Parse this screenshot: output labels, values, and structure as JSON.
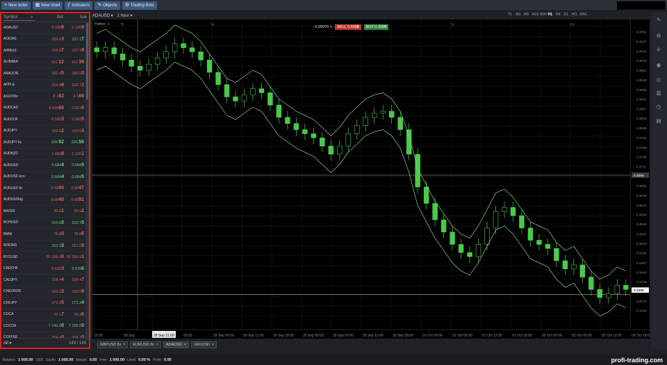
{
  "toolbar": {
    "buttons": [
      {
        "label": "New order",
        "icon": "plus-icon"
      },
      {
        "label": "New chart",
        "icon": "chart-icon"
      },
      {
        "label": "Indicators",
        "icon": "indicators-icon"
      },
      {
        "label": "Objects",
        "icon": "objects-icon"
      },
      {
        "label": "Trading Bots",
        "icon": "bot-icon"
      }
    ]
  },
  "symbols_panel": {
    "search_placeholder": "Symbol",
    "bid_header": "Bid",
    "ask_header": "Ask",
    "rows": [
      {
        "name": "ADAUSD",
        "bid": "0.339",
        "bid_big": "8",
        "ask": "0.339",
        "ask_big": "9",
        "bc": "red",
        "ac": "red"
      },
      {
        "name": "ADIDAS",
        "bid": "226.6",
        "bid_big": "3",
        "ask": "227.1",
        "ask_big": "7",
        "bc": "red",
        "ac": "green"
      },
      {
        "name": "AIRBUS",
        "bid": "126.8",
        "bid_big": "7",
        "ask": "127.1",
        "ask_big": "9",
        "bc": "red",
        "ac": "red"
      },
      {
        "name": "ALIBABA",
        "bid": "112.",
        "bid_big": "12",
        "ask": "112.",
        "ask_big": "39",
        "bc": "red",
        "ac": "red"
      },
      {
        "name": "AMAZON",
        "bid": "182.8",
        "bid_big": "5",
        "ask": "183.0",
        "ask_big": "0",
        "bc": "red",
        "ac": "red"
      },
      {
        "name": "APPLE",
        "bid": "226.4",
        "bid_big": "8",
        "ask": "226.7",
        "ask_big": "1",
        "bc": "red",
        "ac": "red"
      },
      {
        "name": "ASX200v",
        "bid": "8 1",
        "bid_big": "62",
        "ask": "8 1",
        "ask_big": "66",
        "bc": "red",
        "ac": "red"
      },
      {
        "name": "AUDCAD",
        "bid": "0.926",
        "bid_big": "68",
        "ask": "0.927",
        "ask_big": "0",
        "bc": "red",
        "ac": "red"
      },
      {
        "name": "AUDCHF",
        "bid": "0.583",
        "bid_big": "3",
        "ask": "0.583",
        "ask_big": "5",
        "bc": "red",
        "ac": "red"
      },
      {
        "name": "AUDJPY",
        "bid": "100.5",
        "bid_big": "2",
        "ask": "100.5",
        "ask_big": "3",
        "bc": "red",
        "ac": "red"
      },
      {
        "name": "AUDJPY fix",
        "bid": "100.",
        "bid_big": "52",
        "ask": "100.",
        "ask_big": "56",
        "bc": "green",
        "ac": "green"
      },
      {
        "name": "AUDNZD",
        "bid": "1.099",
        "bid_big": "8",
        "ask": "1.100",
        "ask_big": "1",
        "bc": "red",
        "ac": "red"
      },
      {
        "name": "AUDUSD",
        "bid": "0.684",
        "bid_big": "4",
        "ask": "0.684",
        "ask_big": "5",
        "bc": "green",
        "ac": "green"
      },
      {
        "name": "AUDUSD ecn",
        "bid": "0.684",
        "bid_big": "4",
        "ask": "0.684",
        "ask_big": "5",
        "bc": "green",
        "ac": "green"
      },
      {
        "name": "AUDUSD fix",
        "bid": "0.68",
        "bid_big": "44",
        "ask": "0.68",
        "ask_big": "47",
        "bc": "red",
        "ac": "red"
      },
      {
        "name": "AUDUSDbig",
        "bid": "0.68",
        "bid_big": "40",
        "ask": "0.68",
        "ask_big": "51",
        "bc": "red",
        "ac": "red"
      },
      {
        "name": "BAYER",
        "bid": "30.0",
        "bid_big": "1",
        "ask": "30.1",
        "ask_big": "2",
        "bc": "red",
        "ac": "red"
      },
      {
        "name": "BCHUSD",
        "bid": "310.6",
        "bid_big": "0",
        "ask": "310.7",
        "ask_big": "0",
        "bc": "green",
        "ac": "green"
      },
      {
        "name": "BMW",
        "bid": "76.8",
        "bid_big": "0",
        "ask": "76.9",
        "ask_big": "6",
        "bc": "red",
        "ac": "red"
      },
      {
        "name": "BOEING",
        "bid": "151.3",
        "bid_big": "3",
        "ask": "151.6",
        "ask_big": "5",
        "bc": "green",
        "ac": "red"
      },
      {
        "name": "BTCUSD",
        "bid": "65 159.9",
        "bid_big": "0",
        "ask": "65 159.9",
        "ask_big": "1",
        "bc": "red",
        "ac": "red"
      },
      {
        "name": "CADCHF",
        "bid": "0.629",
        "bid_big": "3",
        "ask": "0.629",
        "ask_big": "6",
        "bc": "red",
        "ac": "green"
      },
      {
        "name": "CADJPY",
        "bid": "108.4",
        "bid_big": "4",
        "ask": "108.4",
        "ask_big": "7",
        "bc": "red",
        "ac": "red"
      },
      {
        "name": "CHEVRON",
        "bid": "150.3",
        "bid_big": "3",
        "ask": "150.5",
        "ask_big": "9",
        "bc": "red",
        "ac": "red"
      },
      {
        "name": "CHFJPY",
        "bid": "172.2",
        "bid_big": "5",
        "ask": "172.3",
        "ask_big": "4",
        "bc": "red",
        "ac": "green"
      },
      {
        "name": "COCA",
        "bid": "70.1",
        "bid_big": "7",
        "ask": "70.3",
        "ask_big": "6",
        "bc": "red",
        "ac": "red"
      },
      {
        "name": "COCOA",
        "bid": "7 141.0",
        "bid_big": "0",
        "ask": "7 156.0",
        "ask_big": "0",
        "bc": "green",
        "ac": "green"
      },
      {
        "name": "COFFEE",
        "bid": "254.4",
        "bid_big": "0",
        "ask": "254.7",
        "ask_big": "0",
        "bc": "red",
        "ac": "red"
      }
    ],
    "filter": "All",
    "count": "149 / 149"
  },
  "chart": {
    "symbol": "ADAUSD",
    "timeframe": "1 hour",
    "timeframes": [
      "T1",
      "M1",
      "M5",
      "M15",
      "M30",
      "H1",
      "H4",
      "D1",
      "W1",
      "MN1"
    ],
    "active_timeframe": "H1",
    "hidden_label": "Hidden: 1",
    "spread": "- 0.00070 +",
    "sell_label": "SELL",
    "sell_price": "0.339",
    "sell_big": "8",
    "buy_label": "BUY",
    "buy_price": "0.339",
    "buy_big": "9",
    "days": [
      "Th",
      "Su",
      "Tu",
      "We"
    ],
    "price_labels": [
      "0.4052",
      "0.4027",
      "0.4003",
      "0.3979",
      "0.3954",
      "0.3930",
      "0.3905",
      "0.3881",
      "0.3857",
      "0.3833",
      "0.3808",
      "0.3784",
      "0.3759",
      "0.3735",
      "0.3711",
      "0.3686",
      "0.3662",
      "0.3638",
      "0.3613",
      "0.3589",
      "0.3565",
      "0.3540",
      "0.3516",
      "0.3492",
      "0.3467",
      "0.3443",
      "0.3419",
      "0.3394",
      "0.3370",
      "0.3346"
    ],
    "crosshair_price": "0.3689",
    "current_price": "0.3398",
    "time_labels": [
      "12:00",
      "28 Sep",
      "28 Sep 21:00",
      "00:00",
      "29 Sep 06:00",
      "29 Sep 12:00",
      "29 Sep 18:00",
      "30 Sep 00:00",
      "30 Sep 06:00",
      "30 Sep 12:00",
      "30 Sep 18:00",
      "01 Oct 00:00",
      "01 Oct 06:00",
      "01 Oct 12:00",
      "01 Oct 18:00",
      "02 Oct 00:00",
      "02 Oct 06:00",
      "02 Oct 12:00",
      "02 Oct 18:00"
    ],
    "colors": {
      "bull": "#4cc94c",
      "bear": "#4cc94c",
      "band": "#8fd38f"
    }
  },
  "tabs": [
    "GBPUSD fix",
    "EURUSD fix",
    "ADAUSD",
    "XAUUSD"
  ],
  "active_tab": "ADAUSD",
  "status": {
    "balance_label": "Balance",
    "balance": "1 000.00",
    "currency": "USD",
    "equity_label": "Equity",
    "equity": "1 000.00",
    "margin_label": "Margin",
    "margin": "0.00",
    "free_label": "Free",
    "free": "1 000.00",
    "level_label": "Level",
    "level": "0.00 %",
    "profit_label": "Profit",
    "profit": "0.00"
  },
  "watermark": "profi-trading.com"
}
